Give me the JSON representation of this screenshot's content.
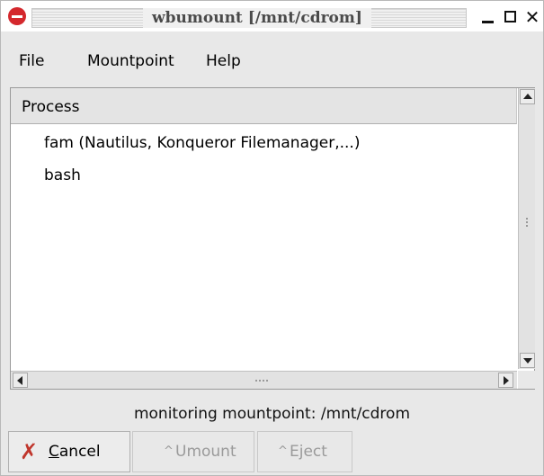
{
  "window": {
    "title": "wbumount [/mnt/cdrom]",
    "controls": {
      "minimize_icon": "minimize-icon",
      "maximize_icon": "maximize-icon",
      "close_glyph": "✕"
    }
  },
  "menu": {
    "items": [
      {
        "label": "File"
      },
      {
        "label": "Mountpoint"
      },
      {
        "label": "Help"
      }
    ]
  },
  "process_list": {
    "header": "Process",
    "rows": [
      {
        "name": "fam (Nautilus, Konqueror Filemanager,...)"
      },
      {
        "name": "bash"
      }
    ]
  },
  "status": {
    "text": "monitoring mountpoint: /mnt/cdrom"
  },
  "buttons": {
    "cancel": {
      "mnemonic": "C",
      "rest": "ancel",
      "icon": "cancel-x-icon",
      "glyph": "✗"
    },
    "umount": {
      "label": "Umount",
      "prefix": "^",
      "enabled": false
    },
    "eject": {
      "label": "Eject",
      "prefix": "^",
      "enabled": false
    }
  },
  "colors": {
    "app_icon": "#d4282d",
    "cancel_icon": "#c0362c",
    "disabled_text": "#9a9a9a"
  }
}
